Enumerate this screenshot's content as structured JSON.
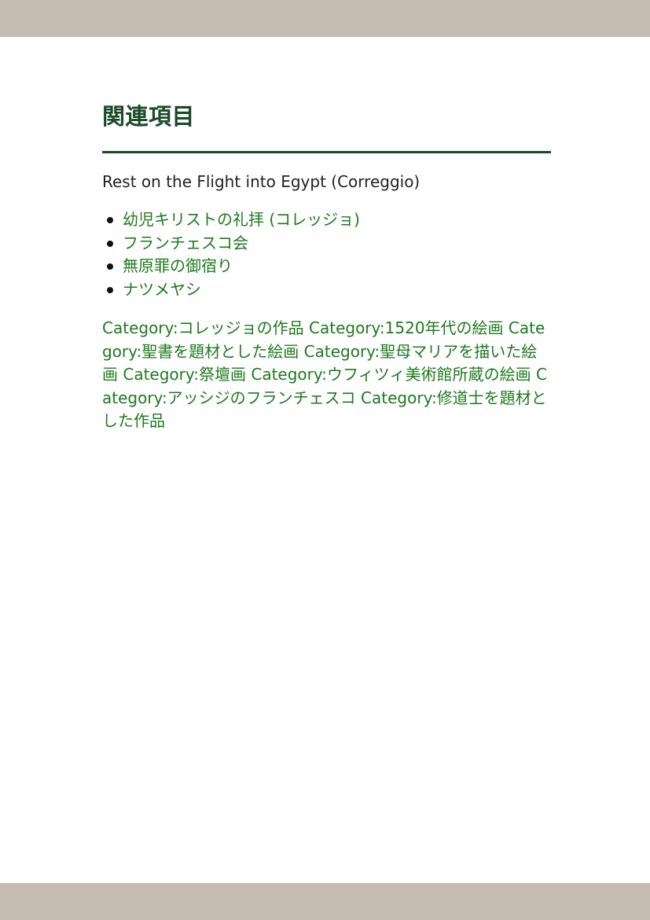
{
  "colors": {
    "bar": "#c5bbb1",
    "heading": "#1b4a2a",
    "link": "#1e7a1e",
    "text": "#222222"
  },
  "section": {
    "heading": "関連項目",
    "intro": "Rest on the Flight into Egypt (Correggio)",
    "links": [
      "幼児キリストの礼拝 (コレッジョ)",
      "フランチェスコ会",
      "無原罪の御宿り",
      "ナツメヤシ"
    ],
    "categories": [
      "Category:コレッジョの作品",
      "Category:1520年代の絵画",
      "Category:聖書を題材とした絵画",
      "Category:聖母マリアを描いた絵画",
      "Category:祭壇画",
      "Category:ウフィツィ美術館所蔵の絵画",
      "Category:アッシジのフランチェスコ",
      "Category:修道士を題材とした作品"
    ]
  }
}
